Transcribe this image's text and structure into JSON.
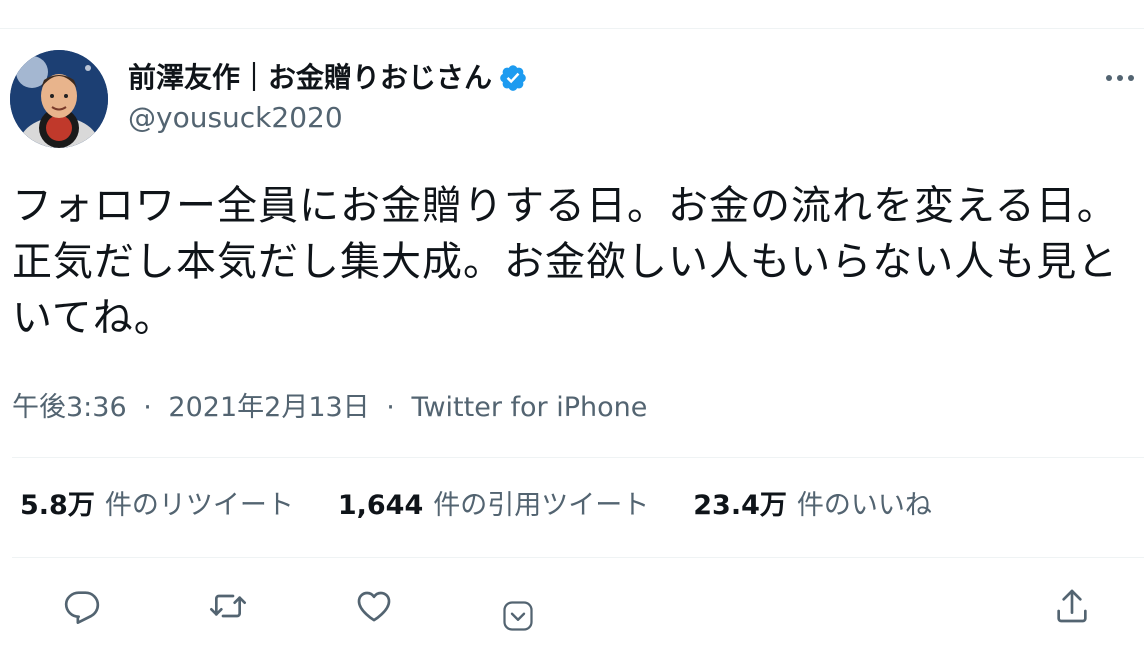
{
  "tweet": {
    "display_name": "前澤友作｜お金贈りおじさん",
    "handle": "@yousuck2020",
    "text": "フォロワー全員にお金贈りする日。お金の流れを変える日。正気だし本気だし集大成。お金欲しい人もいらない人も見といてね。",
    "time": "午後3:36",
    "date": "2021年2月13日",
    "separator": "·",
    "source": "Twitter for iPhone"
  },
  "stats": {
    "retweets": {
      "num": "5.8万",
      "label": "件のリツイート"
    },
    "quotes": {
      "num": "1,644",
      "label": "件の引用ツイート"
    },
    "likes": {
      "num": "23.4万",
      "label": "件のいいね"
    }
  },
  "icons": {
    "verified": "verified-badge-icon",
    "more": "more-horizontal-icon",
    "reply": "reply-icon",
    "retweet": "retweet-icon",
    "like": "heart-icon",
    "chevron": "chevron-down-icon",
    "share": "share-icon"
  },
  "colors": {
    "text_primary": "#0f1419",
    "text_secondary": "#536471",
    "verified_blue": "#1d9bf0",
    "divider": "#eff3f4"
  }
}
